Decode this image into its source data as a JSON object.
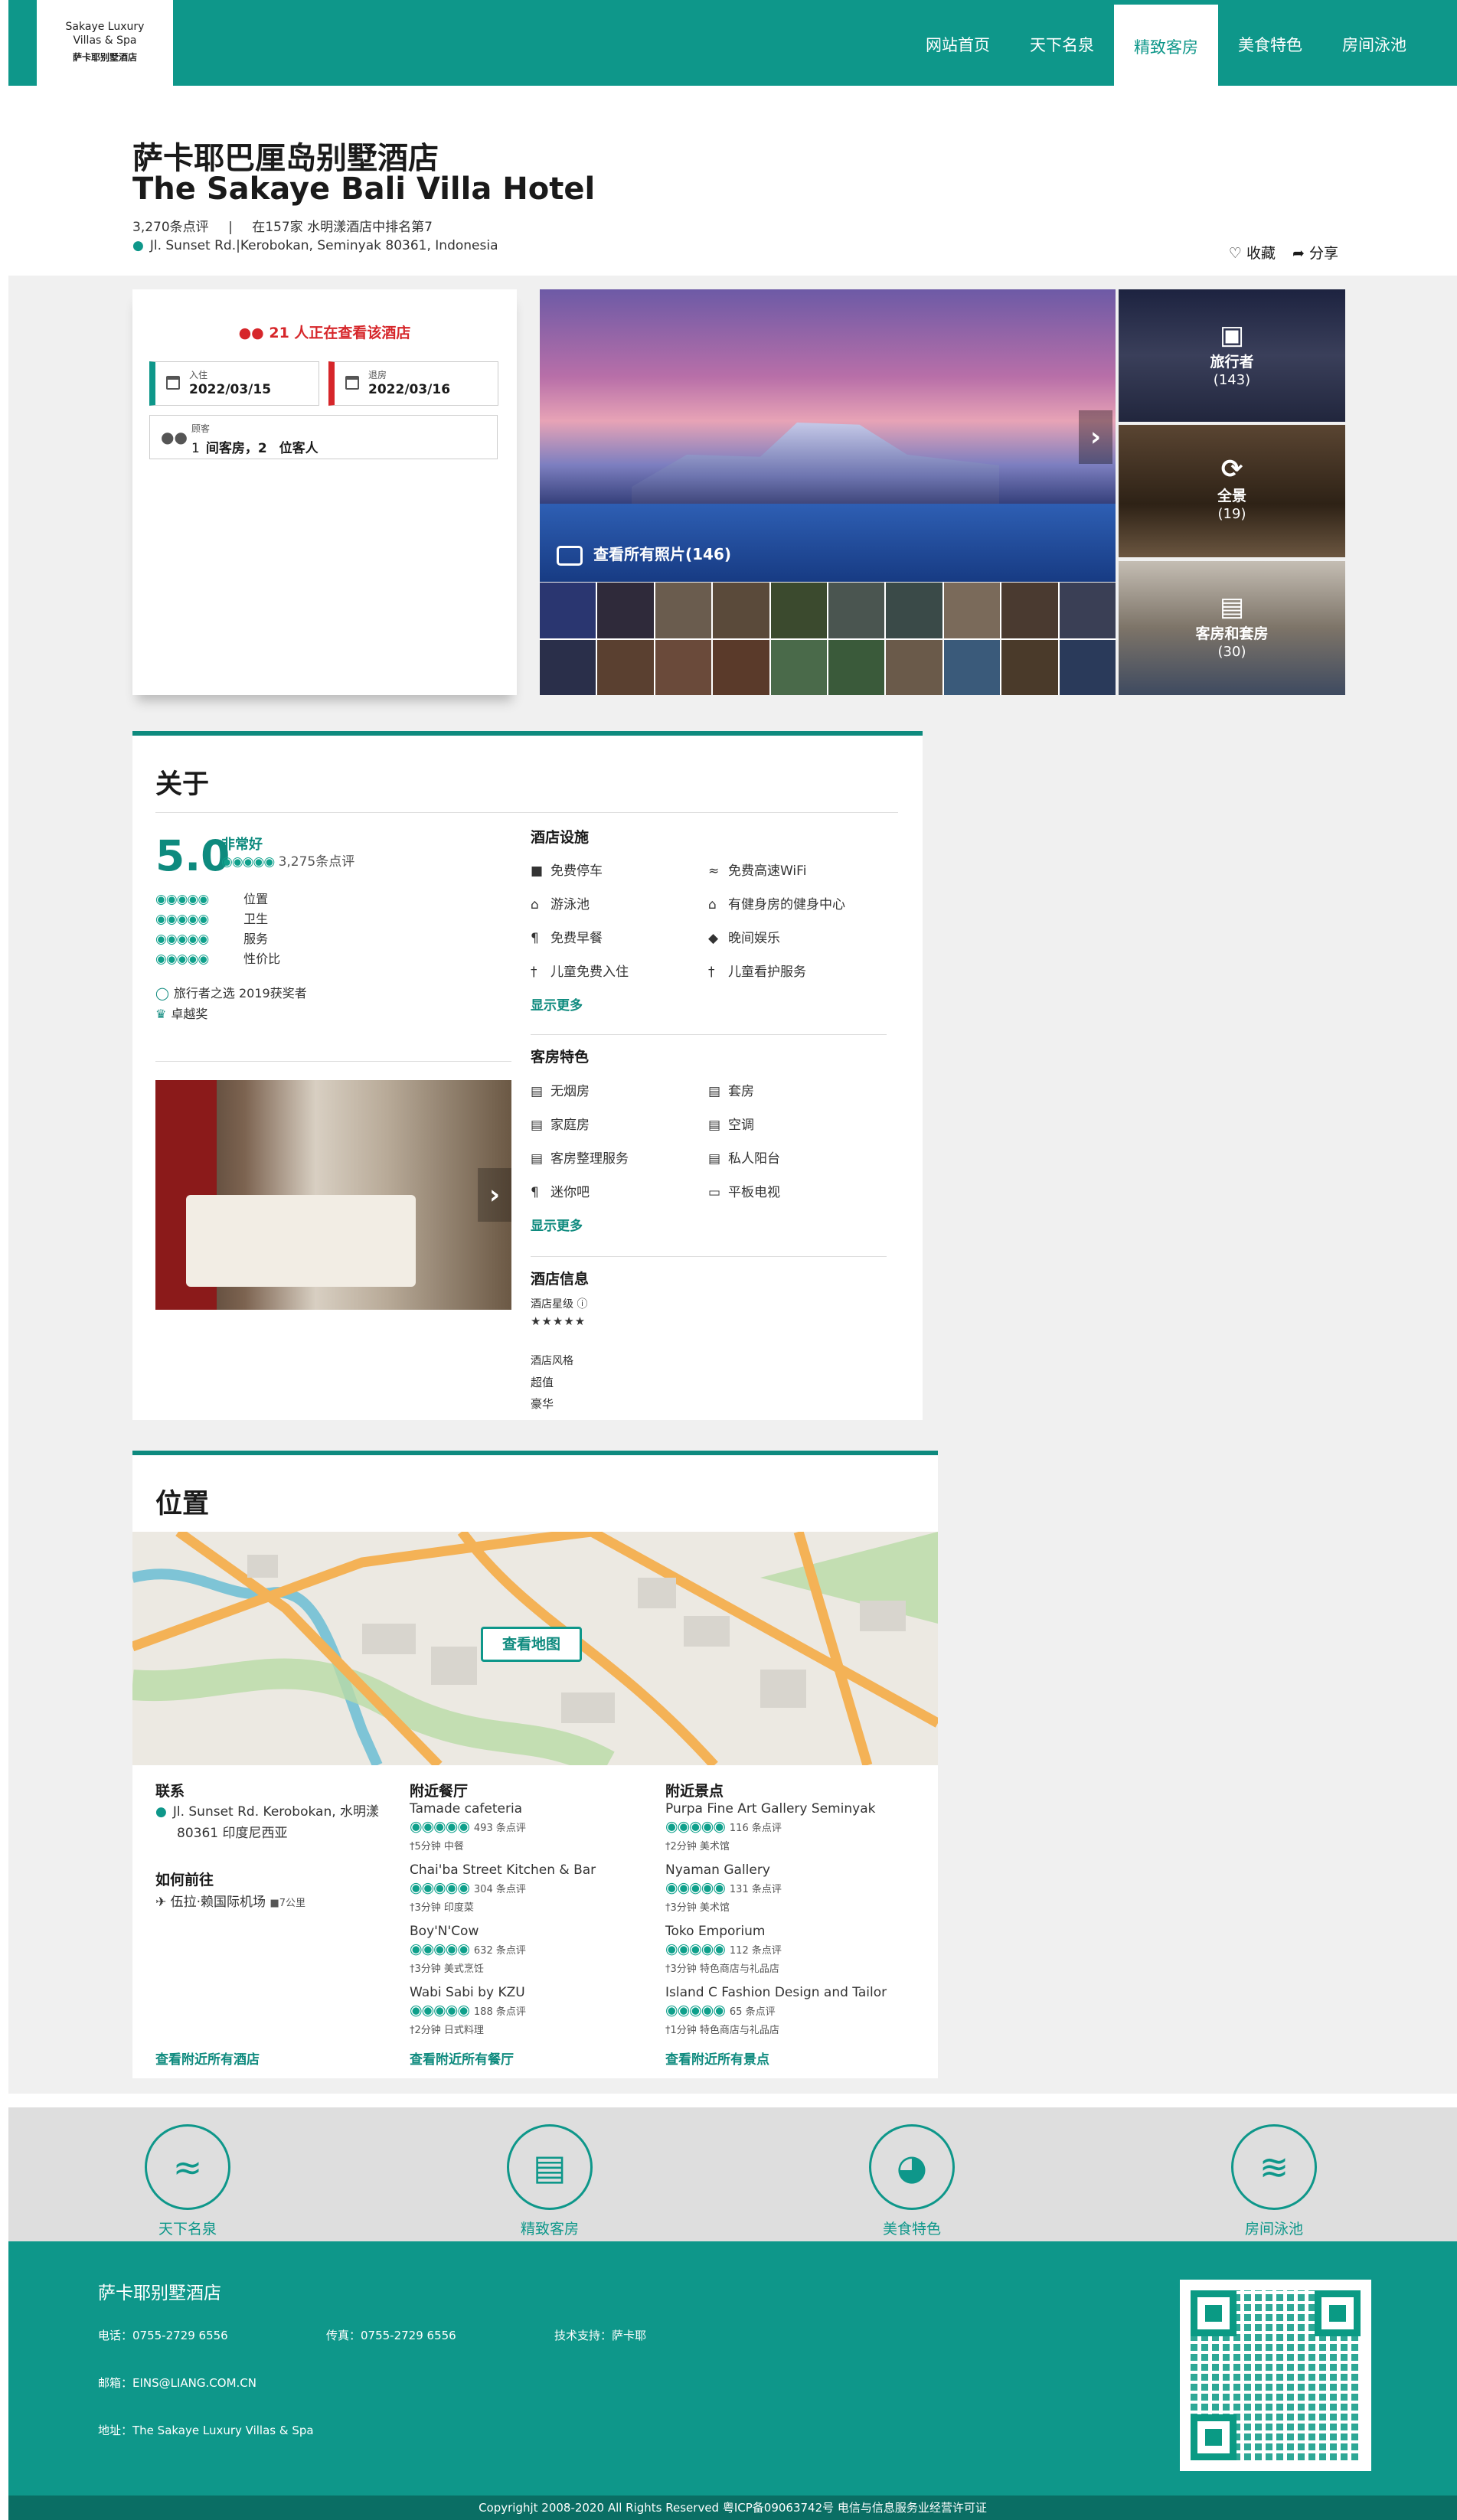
{
  "brand": {
    "logo_line1": "Sakaye Luxury",
    "logo_line2": "Villas & Spa",
    "logo_cn": "萨卡耶别墅酒店"
  },
  "nav": [
    "网站首页",
    "天下名泉",
    "精致客房",
    "美食特色",
    "房间泳池"
  ],
  "nav_active_index": 2,
  "hotel": {
    "name_cn": "萨卡耶巴厘岛别墅酒店",
    "name_en": "The Sakaye Bali Villa Hotel",
    "reviews": "3,270条点评",
    "separator": "|",
    "rank": "在157家 水明漾酒店中排名第7",
    "address": "Jl. Sunset Rd.|Kerobokan, Seminyak 80361, Indonesia",
    "save": "收藏",
    "share": "分享"
  },
  "booking": {
    "viewers": "21 人正在查看该酒店",
    "checkin_label": "入住",
    "checkin": "2022/03/15",
    "checkout_label": "退房",
    "checkout": "2022/03/16",
    "guests_label": "顾客",
    "rooms_n": "1",
    "rooms_unit": "间客房，2",
    "guests_unit": "位客人"
  },
  "photos": {
    "all": "查看所有照片(146)",
    "traveler": "旅行者",
    "traveler_n": "(143)",
    "panorama": "全景",
    "panorama_n": "(19)",
    "rooms": "客房和套房",
    "rooms_n": "(30)"
  },
  "about": {
    "title": "关于",
    "score": "5.0",
    "score_label": "非常好",
    "score_count": "3,275条点评",
    "ratings": [
      "位置",
      "卫生",
      "服务",
      "性价比"
    ],
    "award1": "旅行者之选 2019获奖者",
    "award2": "卓越奖",
    "amenities_title": "酒店设施",
    "amenities": [
      [
        "免费停车",
        "免费高速WiFi"
      ],
      [
        "游泳池",
        "有健身房的健身中心"
      ],
      [
        "免费早餐",
        "晚间娱乐"
      ],
      [
        "儿童免费入住",
        "儿童看护服务"
      ]
    ],
    "show_more": "显示更多",
    "room_title": "客房特色",
    "room_features": [
      [
        "无烟房",
        "套房"
      ],
      [
        "家庭房",
        "空调"
      ],
      [
        "客房整理服务",
        "私人阳台"
      ],
      [
        "迷你吧",
        "平板电视"
      ]
    ],
    "info_title": "酒店信息",
    "star_label": "酒店星级",
    "style_label": "酒店风格",
    "style1": "超值",
    "style2": "豪华"
  },
  "location": {
    "title": "位置",
    "view_map": "查看地图",
    "contact_title": "联系",
    "contact_addr1": "Jl. Sunset Rd. Kerobokan, 水明漾",
    "contact_addr2": "80361 印度尼西亚",
    "howto_title": "如何前往",
    "airport": "伍拉·赖国际机场",
    "airport_dist": "7公里",
    "restaurants_title": "附近餐厅",
    "restaurants": [
      {
        "name": "Tamade cafeteria",
        "reviews": "493 条点评",
        "dist": "5分钟",
        "type": "中餐"
      },
      {
        "name": "Chai'ba Street Kitchen & Bar",
        "reviews": "304 条点评",
        "dist": "3分钟",
        "type": "印度菜"
      },
      {
        "name": "Boy'N'Cow",
        "reviews": "632 条点评",
        "dist": "3分钟",
        "type": "美式烹饪"
      },
      {
        "name": "Wabi Sabi by KZU",
        "reviews": "188 条点评",
        "dist": "2分钟",
        "type": "日式料理"
      }
    ],
    "attractions_title": "附近景点",
    "attractions": [
      {
        "name": "Purpa Fine Art Gallery Seminyak",
        "reviews": "116 条点评",
        "dist": "2分钟",
        "type": "美术馆"
      },
      {
        "name": "Nyaman Gallery",
        "reviews": "131 条点评",
        "dist": "3分钟",
        "type": "美术馆"
      },
      {
        "name": "Toko Emporium",
        "reviews": "112 条点评",
        "dist": "3分钟",
        "type": "特色商店与礼品店"
      },
      {
        "name": "Island C Fashion Design and Tailor",
        "reviews": "65 条点评",
        "dist": "1分钟",
        "type": "特色商店与礼品店"
      }
    ],
    "more_hotels": "查看附近所有酒店",
    "more_restaurants": "查看附近所有餐厅",
    "more_attractions": "查看附近所有景点"
  },
  "iconbar": [
    "天下名泉",
    "精致客房",
    "美食特色",
    "房间泳池"
  ],
  "footer": {
    "name": "萨卡耶别墅酒店",
    "phone": "电话：0755-2729 6556",
    "fax": "传真：0755-2729 6556",
    "support": "技术支持：萨卡耶",
    "email": "邮箱：EINS@LIANG.COM.CN",
    "address": "地址：The Sakaye Luxury Villas & Spa",
    "copyright": "Copyrighjt 2008-2020 All Rights Reserved 粤ICP备09063742号 电信与信息服务业经营许可证"
  },
  "colors": {
    "brand": "#0e978a",
    "accent_red": "#d6262a"
  }
}
